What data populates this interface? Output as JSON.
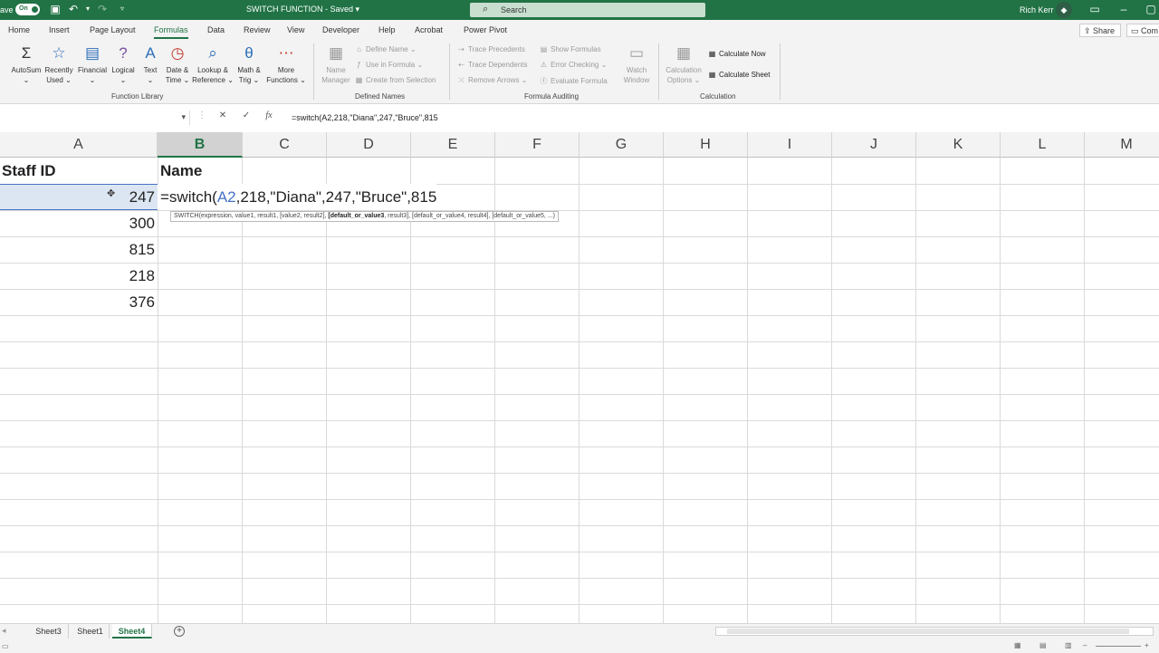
{
  "titlebar": {
    "autosave_label": "ave",
    "autosave_state": "On",
    "doc_title": "SWITCH FUNCTION  -  Saved  ▾",
    "search_placeholder": "Search",
    "user_name": "Rich Kerr",
    "accent_color": "#217346"
  },
  "tabs": [
    "Home",
    "Insert",
    "Page Layout",
    "Formulas",
    "Data",
    "Review",
    "View",
    "Developer",
    "Help",
    "Acrobat",
    "Power Pivot"
  ],
  "active_tab": "Formulas",
  "share_label": "Share",
  "comments_label": "Com",
  "ribbon": {
    "function_library": {
      "label": "Function Library",
      "buttons": [
        {
          "l1": "AutoSum",
          "l2": "⌄",
          "icon": "sigma-icon"
        },
        {
          "l1": "Recently",
          "l2": "Used ⌄",
          "icon": "star-book-icon"
        },
        {
          "l1": "Financial",
          "l2": "⌄",
          "icon": "financial-book-icon"
        },
        {
          "l1": "Logical",
          "l2": "⌄",
          "icon": "question-book-icon"
        },
        {
          "l1": "Text",
          "l2": "⌄",
          "icon": "text-book-icon"
        },
        {
          "l1": "Date &",
          "l2": "Time ⌄",
          "icon": "clock-book-icon"
        },
        {
          "l1": "Lookup &",
          "l2": "Reference ⌄",
          "icon": "magnifier-book-icon"
        },
        {
          "l1": "Math &",
          "l2": "Trig ⌄",
          "icon": "theta-book-icon"
        },
        {
          "l1": "More",
          "l2": "Functions ⌄",
          "icon": "more-book-icon"
        }
      ]
    },
    "defined_names": {
      "label": "Defined Names",
      "name_manager": {
        "l1": "Name",
        "l2": "Manager"
      },
      "items": [
        "Define Name  ⌄",
        "Use in Formula  ⌄",
        "Create from Selection"
      ]
    },
    "formula_auditing": {
      "label": "Formula Auditing",
      "items_left": [
        "Trace Precedents",
        "Trace Dependents",
        "Remove Arrows  ⌄"
      ],
      "items_right": [
        "Show Formulas",
        "Error Checking  ⌄",
        "Evaluate Formula"
      ],
      "watch": {
        "l1": "Watch",
        "l2": "Window"
      }
    },
    "calculation": {
      "label": "Calculation",
      "options": {
        "l1": "Calculation",
        "l2": "Options ⌄"
      },
      "items": [
        "Calculate Now",
        "Calculate Sheet"
      ]
    }
  },
  "formula_bar": {
    "name_box": "▾",
    "cancel": "✕",
    "enter": "✓",
    "fx": "fx",
    "formula": "=switch(A2,218,\"Diana\",247,\"Bruce\",815"
  },
  "columns": [
    "A",
    "B",
    "C",
    "D",
    "E",
    "F",
    "G",
    "H",
    "I",
    "J",
    "K",
    "L",
    "M"
  ],
  "selected_column": "B",
  "cells": {
    "a1": "Staff ID",
    "b1": "Name",
    "a_values": [
      "247",
      "300",
      "815",
      "218",
      "376"
    ]
  },
  "editing": {
    "prefix": "=switch(",
    "ref": "A2",
    "suffix": ",218,\"Diana\",247,\"Bruce\",815",
    "tooltip_pre": "SWITCH(expression, value1, result1, [value2, result2], ",
    "tooltip_bold": "[default_or_value3",
    "tooltip_post": ", result3], [default_or_value4, result4], [default_or_value5, ...)"
  },
  "sheets": [
    "Sheet3",
    "Sheet1",
    "Sheet4"
  ],
  "active_sheet": "Sheet4",
  "add_sheet": "+"
}
